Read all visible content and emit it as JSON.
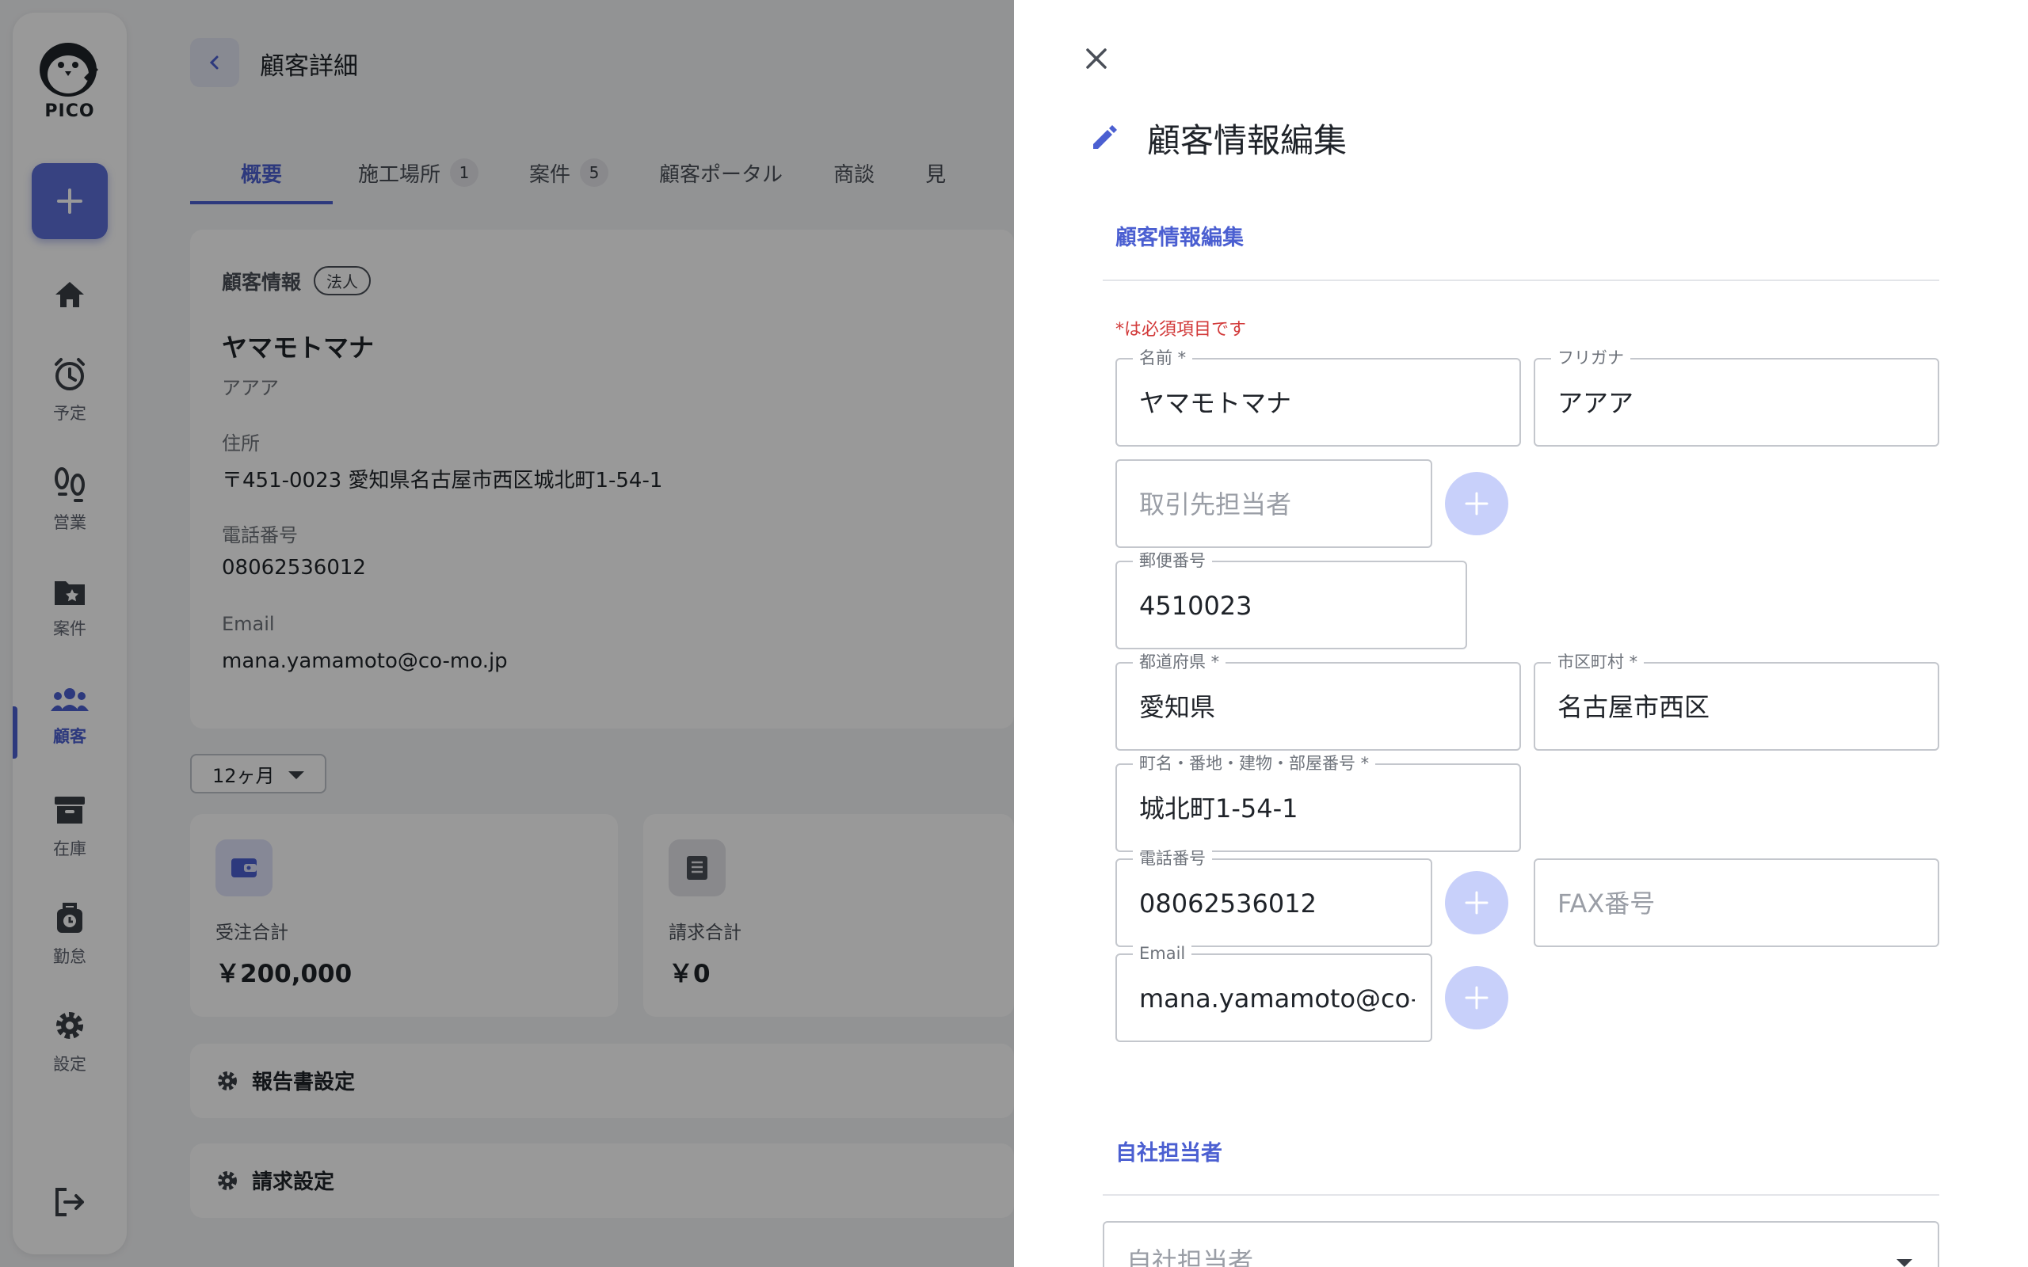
{
  "sidebar": {
    "logo_text": "PICO",
    "items": [
      {
        "icon": "home-icon",
        "label": ""
      },
      {
        "icon": "alarm-clock-icon",
        "label": "予定"
      },
      {
        "icon": "footprints-icon",
        "label": "営業"
      },
      {
        "icon": "folder-star-icon",
        "label": "案件"
      },
      {
        "icon": "people-group-icon",
        "label": "顧客"
      },
      {
        "icon": "archive-box-icon",
        "label": "在庫"
      },
      {
        "icon": "timer-bag-icon",
        "label": "勤怠"
      },
      {
        "icon": "gear-icon",
        "label": "設定"
      }
    ],
    "active_item": "顧客",
    "accent_color": "#5c6fd8"
  },
  "header": {
    "title": "顧客詳細"
  },
  "tabs": [
    {
      "label": "概要",
      "badge": ""
    },
    {
      "label": "施工場所",
      "badge": "1"
    },
    {
      "label": "案件",
      "badge": "5"
    },
    {
      "label": "顧客ポータル",
      "badge": ""
    },
    {
      "label": "商談",
      "badge": ""
    },
    {
      "label": "見",
      "badge": ""
    }
  ],
  "customer_info": {
    "heading": "顧客情報",
    "type_chip": "法人",
    "name": "ヤマモトマナ",
    "kana": "アアア",
    "address_label": "住所",
    "address_value": "〒451-0023 愛知県名古屋市西区城北町1-54-1",
    "phone_label": "電話番号",
    "phone_value": "08062536012",
    "email_label": "Email",
    "email_value": "mana.yamamoto@co-mo.jp"
  },
  "period_select": "12ヶ月",
  "stats": [
    {
      "label": "受注合計",
      "value": "￥200,000"
    },
    {
      "label": "請求合計",
      "value": "￥0"
    }
  ],
  "settings": [
    {
      "label": "報告書設定"
    },
    {
      "label": "請求設定"
    }
  ],
  "drawer": {
    "title": "顧客情報編集",
    "section1": "顧客情報編集",
    "required_note": "*は必須項目です",
    "fields": {
      "name": {
        "label": "名前 *",
        "value": "ヤマモトマナ"
      },
      "furigana": {
        "label": "フリガナ",
        "value": "アアア"
      },
      "contact_person": {
        "placeholder": "取引先担当者"
      },
      "postal": {
        "label": "郵便番号",
        "value": "4510023"
      },
      "prefecture": {
        "label": "都道府県 *",
        "value": "愛知県"
      },
      "city": {
        "label": "市区町村 *",
        "value": "名古屋市西区"
      },
      "street": {
        "label": "町名・番地・建物・部屋番号 *",
        "value": "城北町1-54-1"
      },
      "phone": {
        "label": "電話番号",
        "value": "08062536012"
      },
      "fax": {
        "placeholder": "FAX番号"
      },
      "email": {
        "label": "Email",
        "value": "mana.yamamoto@co-mo.jp"
      }
    },
    "section2": "自社担当者",
    "staff_select_placeholder": "自社担当者"
  }
}
